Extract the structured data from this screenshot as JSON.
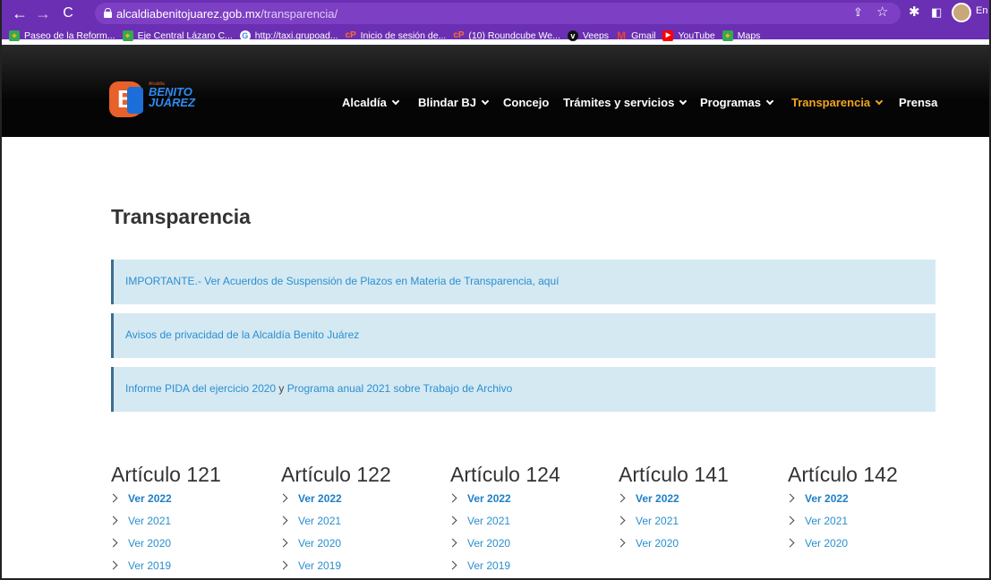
{
  "browser": {
    "url_domain": "alcaldiabenitojuarez.gob.mx",
    "url_path": "/transparencia/",
    "profile_text": "En p",
    "colors": {
      "chrome": "#6b2fb3"
    }
  },
  "bookmarks": [
    {
      "label": "Paseo de la Reform...",
      "icon": "maps-pin-icon"
    },
    {
      "label": "Eje Central Lázaro C...",
      "icon": "maps-pin-icon"
    },
    {
      "label": "http://taxi.grupoad...",
      "icon": "google-icon"
    },
    {
      "label": "Inicio de sesión de...",
      "icon": "cpanel-icon"
    },
    {
      "label": "(10) Roundcube We...",
      "icon": "cpanel-icon"
    },
    {
      "label": "Veeps",
      "icon": "veeps-icon"
    },
    {
      "label": "Gmail",
      "icon": "gmail-icon"
    },
    {
      "label": "YouTube",
      "icon": "youtube-icon"
    },
    {
      "label": "Maps",
      "icon": "maps-icon"
    }
  ],
  "site": {
    "logo": {
      "mark": "BJ",
      "small": "Alcaldía",
      "line1": "BENITO",
      "line2": "JUÁREZ"
    },
    "nav": [
      {
        "label": "Alcaldía",
        "dropdown": true
      },
      {
        "label": "Blindar BJ",
        "dropdown": true
      },
      {
        "label": "Concejo",
        "dropdown": false
      },
      {
        "label": "Trámites y servicios",
        "dropdown": true
      },
      {
        "label": "Programas",
        "dropdown": true
      },
      {
        "label": "Transparencia",
        "dropdown": true,
        "active": true
      },
      {
        "label": "Prensa",
        "dropdown": false
      }
    ],
    "active_color": "#f0a51e"
  },
  "page": {
    "title": "Transparencia",
    "notices": {
      "n1": "IMPORTANTE.- Ver Acuerdos de Suspensión de Plazos en Materia de Transparencia, aquí",
      "n2": "Avisos de privacidad de la Alcaldía Benito Juárez",
      "n3_link1": "Informe PIDA del ejercicio 2020",
      "n3_mid": " y ",
      "n3_link2": "Programa anual 2021 sobre Trabajo de Archivo"
    },
    "articles": [
      {
        "title": "Artículo 121",
        "links": [
          "Ver 2022",
          "Ver 2021",
          "Ver 2020",
          "Ver 2019"
        ]
      },
      {
        "title": "Artículo 122",
        "links": [
          "Ver 2022",
          "Ver 2021",
          "Ver 2020",
          "Ver 2019"
        ]
      },
      {
        "title": "Artículo 124",
        "links": [
          "Ver 2022",
          "Ver 2021",
          "Ver 2020",
          "Ver 2019"
        ]
      },
      {
        "title": "Artículo 141",
        "links": [
          "Ver 2022",
          "Ver 2021",
          "Ver 2020"
        ]
      },
      {
        "title": "Artículo 142",
        "links": [
          "Ver 2022",
          "Ver 2021",
          "Ver 2020"
        ]
      }
    ]
  }
}
